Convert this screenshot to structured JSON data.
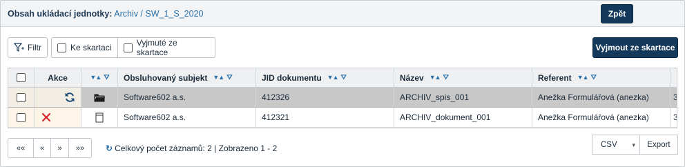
{
  "header": {
    "label": "Obsah ukládací jednotky:",
    "breadcrumb": "Archiv / SW_1_S_2020",
    "back_button": "Zpět"
  },
  "toolbar": {
    "filter_label": "Filtr",
    "ke_skartaci_label": "Ke skartaci",
    "vyjmute_label": "Vyjmuté ze skartace",
    "remove_button": "Vyjmout ze skartace"
  },
  "table": {
    "columns": {
      "akce": "Akce",
      "subject": "Obsluhovaný subjekt",
      "jid": "JID dokumentu",
      "name": "Název",
      "referent": "Referent"
    },
    "rows": [
      {
        "subject": "Software602 a.s.",
        "jid": "412326",
        "name": "ARCHIV_spis_001",
        "referent": "Anežka Formulářová (anezka)",
        "extra": "3",
        "type_icon": "folder-icon",
        "action_icon": "refresh-icon"
      },
      {
        "subject": "Software602 a.s.",
        "jid": "412321",
        "name": "ARCHIV_dokument_001",
        "referent": "Anežka Formulářová (anezka)",
        "extra": "3",
        "type_icon": "document-icon",
        "action_icon": "delete-x-icon"
      }
    ]
  },
  "pager": {
    "first": "««",
    "prev": "«",
    "next": "»",
    "last": "»»",
    "summary": "Celkový počet záznamů: 2 | Zobrazeno 1 - 2"
  },
  "export": {
    "format": "CSV",
    "button": "Export"
  },
  "colors": {
    "primary": "#14395a",
    "link": "#2a6fa8",
    "selected_row": "#c8c8c8",
    "delete": "#d9262b"
  }
}
